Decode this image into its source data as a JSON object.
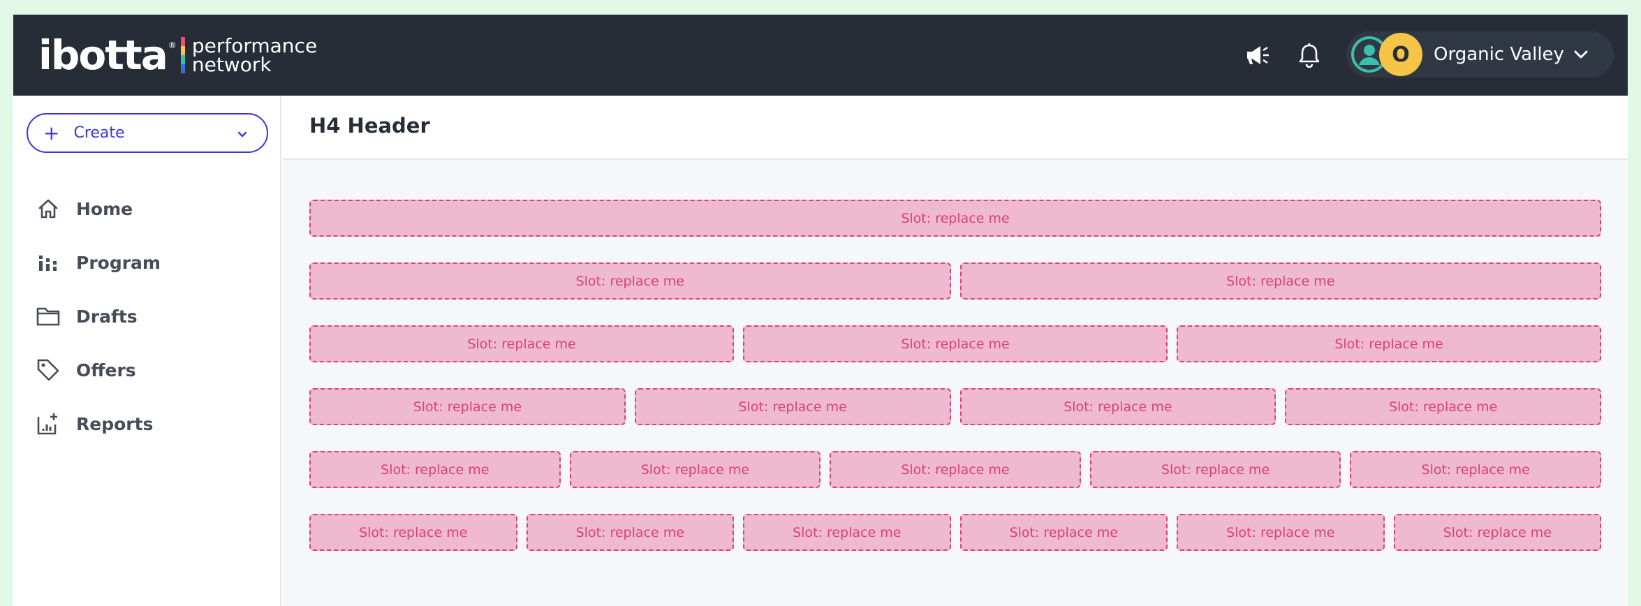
{
  "brand": {
    "wordmark": "ibotta",
    "registered": "®",
    "sub_line1": "performance",
    "sub_line2": "network",
    "bar_colors": [
      "#f04e7c",
      "#f6c547",
      "#3bbfad",
      "#3b6fd6"
    ]
  },
  "header": {
    "announcements_icon": "megaphone-icon",
    "notifications_icon": "bell-icon",
    "user_icon": "user-circle-icon",
    "avatar_initial": "O",
    "org_name": "Organic Valley",
    "org_menu_icon": "chevron-down-icon"
  },
  "sidebar": {
    "create_label": "Create",
    "items": [
      {
        "label": "Home",
        "icon": "home-icon"
      },
      {
        "label": "Program",
        "icon": "program-icon"
      },
      {
        "label": "Drafts",
        "icon": "folder-icon"
      },
      {
        "label": "Offers",
        "icon": "tag-icon"
      },
      {
        "label": "Reports",
        "icon": "reports-icon"
      }
    ]
  },
  "main": {
    "title": "H4 Header",
    "slot_rows": [
      {
        "slots": [
          "Slot: replace me"
        ]
      },
      {
        "slots": [
          "Slot: replace me",
          "Slot: replace me"
        ]
      },
      {
        "slots": [
          "Slot: replace me",
          "Slot: replace me",
          "Slot: replace me"
        ]
      },
      {
        "slots": [
          "Slot: replace me",
          "Slot: replace me",
          "Slot: replace me",
          "Slot: replace me"
        ]
      },
      {
        "slots": [
          "Slot: replace me",
          "Slot: replace me",
          "Slot: replace me",
          "Slot: replace me",
          "Slot: replace me"
        ]
      },
      {
        "slots": [
          "Slot: replace me",
          "Slot: replace me",
          "Slot: replace me",
          "Slot: replace me",
          "Slot: replace me",
          "Slot: replace me"
        ]
      }
    ]
  },
  "colors": {
    "topbar": "#272d37",
    "accent": "#3b37d6",
    "slot_fill": "#efbad0",
    "slot_border": "#d8436f",
    "avatar": "#f6c547",
    "user_icon": "#3bbfad"
  }
}
